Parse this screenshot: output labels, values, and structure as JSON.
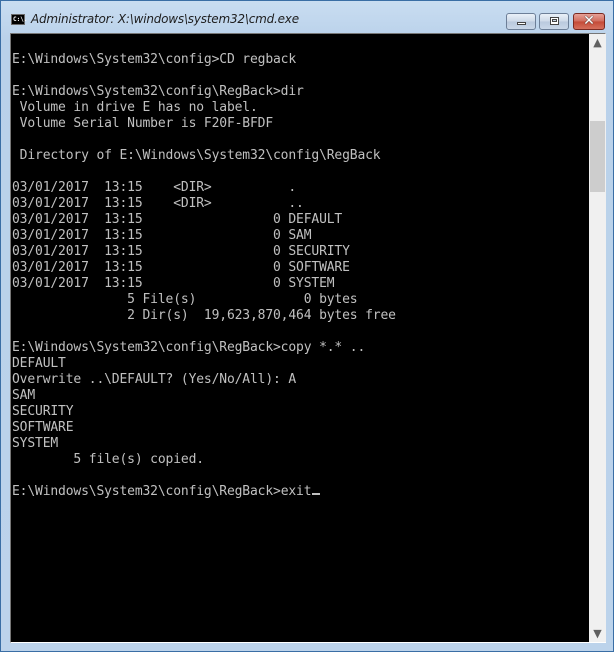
{
  "window": {
    "title": "Administrator: X:\\windows\\system32\\cmd.exe",
    "icon": "cmd-icon",
    "icon_text": "C:\\.",
    "controls": {
      "minimize": "minimize-icon",
      "maximize": "maximize-icon",
      "close_glyph": "✕"
    }
  },
  "console": {
    "lines": [
      "E:\\Windows\\System32\\config>CD regback",
      "",
      "E:\\Windows\\System32\\config\\RegBack>dir",
      " Volume in drive E has no label.",
      " Volume Serial Number is F20F-BFDF",
      "",
      " Directory of E:\\Windows\\System32\\config\\RegBack",
      "",
      "03/01/2017  13:15    <DIR>          .",
      "03/01/2017  13:15    <DIR>          ..",
      "03/01/2017  13:15                 0 DEFAULT",
      "03/01/2017  13:15                 0 SAM",
      "03/01/2017  13:15                 0 SECURITY",
      "03/01/2017  13:15                 0 SOFTWARE",
      "03/01/2017  13:15                 0 SYSTEM",
      "               5 File(s)              0 bytes",
      "               2 Dir(s)  19,623,870,464 bytes free",
      "",
      "E:\\Windows\\System32\\config\\RegBack>copy *.* ..",
      "DEFAULT",
      "Overwrite ..\\DEFAULT? (Yes/No/All): A",
      "SAM",
      "SECURITY",
      "SOFTWARE",
      "SYSTEM",
      "        5 file(s) copied.",
      ""
    ],
    "current_prompt": "E:\\Windows\\System32\\config\\RegBack>",
    "current_input": "exit"
  },
  "scrollbar": {
    "up_glyph": "⌃",
    "down_glyph": "⌄",
    "position_fraction": 0.14
  },
  "colors": {
    "console_bg": "#000000",
    "console_fg": "#c0c0c0",
    "frame": "#bcd3eb",
    "close_button": "#c44a37"
  }
}
